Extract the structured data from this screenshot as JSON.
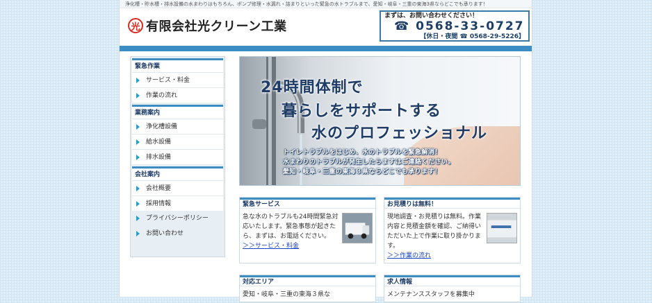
{
  "header": {
    "tagline": "浄化槽・貯水槽・排水設備の水まわりはもちろん、ポンプ修理・水漏れ・詰まりといった緊急の水トラブルまで、愛知・岐阜・三重の東海3県ならどこでも承ります！",
    "logo_mark": "光",
    "company_name": "有限会社光クリーン工業",
    "contact_lead": "まずは、お問い合わせください！",
    "phone_icon": "☎",
    "phone_main": "0568-33-0727",
    "phone_sub": "【休日・夜間 ☎ 0568-29-5226】"
  },
  "sidebar": {
    "sections": [
      {
        "title": "緊急作業",
        "items": [
          "サービス・料金",
          "作業の流れ"
        ]
      },
      {
        "title": "業務案内",
        "items": [
          "浄化槽設備",
          "給水設備",
          "排水設備"
        ]
      },
      {
        "title": "会社案内",
        "items": [
          "会社概要",
          "採用情報"
        ]
      }
    ],
    "extra_items": [
      "プライバシーポリシー",
      "お問い合わせ"
    ]
  },
  "hero": {
    "line1": "24時間体制で",
    "line2": "暮らしをサポートする",
    "line3": "水のプロフェッショナル",
    "sub1": "トイレトラブルをはじめ、水のトラブルを緊急解消！",
    "sub2": "水まわりのトラブルが発生したらますはご連絡ください。",
    "sub3": "愛知・岐阜・三重の東海３県ならどこでも承ります！"
  },
  "cards": [
    {
      "title": "緊急サービス",
      "text": "急な水のトラブルも24時間緊急対応いたします。緊急事態が起きたら、まずは、お電話ください。",
      "link": "＞＞サービス・料金"
    },
    {
      "title": "お見積りは無料！",
      "text": "現地調査・お見積りは無料。作業内容と見積金額を確認、ご納得いただいた上で作業に取り掛かります。",
      "link": "＞＞作業の流れ"
    },
    {
      "title": "対応エリア",
      "text": "愛知・岐阜・三重の東海３県な",
      "link": ""
    },
    {
      "title": "求人情報",
      "text": "メンテナンススタッフを募集中",
      "link": ""
    }
  ],
  "colors": {
    "accent": "#3d8cc2",
    "heading": "#1e3c66",
    "logo": "#d62b22",
    "link": "#1a44c8"
  }
}
